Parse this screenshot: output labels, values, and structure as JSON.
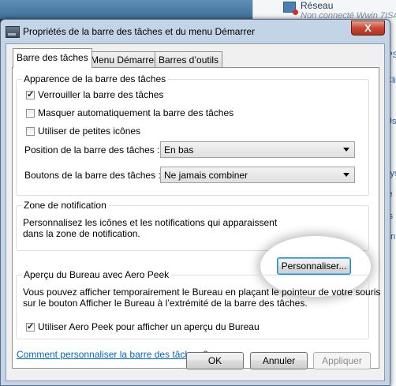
{
  "background": {
    "network_title": "Réseau",
    "network_status": "Non connecté Wwin 7ISA",
    "fragments": [
      "SPS",
      "Cli",
      "Us",
      "sys",
      "ie",
      "rs",
      "en"
    ]
  },
  "window": {
    "title": "Propriétés de la barre des tâches et du menu Démarrer",
    "close_label": "X"
  },
  "tabs": [
    {
      "label": "Barre des tâches"
    },
    {
      "label": "Menu Démarrer"
    },
    {
      "label": "Barres d’outils"
    }
  ],
  "appearance": {
    "group_label": "Apparence de la barre des tâches",
    "lock_label": "Verrouiller la barre des tâches",
    "lock_checked": true,
    "autohide_label": "Masquer automatiquement la barre des tâches",
    "autohide_checked": false,
    "small_icons_label": "Utiliser de petites icônes",
    "small_icons_checked": false,
    "position_label": "Position de la barre des tâches :",
    "position_value": "En bas",
    "buttons_label": "Boutons de la barre des tâches :",
    "buttons_value": "Ne jamais combiner"
  },
  "notification": {
    "group_label": "Zone de notification",
    "text_line1": "Personnalisez les icônes et les notifications qui apparaissent",
    "text_line2": "dans la zone de notification.",
    "customize_button": "Personnaliser..."
  },
  "aero_peek": {
    "group_label": "Aperçu du Bureau avec Aero Peek",
    "text_line1": "Vous pouvez afficher temporairement le Bureau en plaçant le pointeur de votre souris",
    "text_line2": "sur le bouton Afficher le Bureau à l’extrémité de la barre des tâches.",
    "checkbox_label": "Utiliser Aero Peek pour afficher un aperçu du Bureau",
    "checked": true
  },
  "help_link": "Comment personnaliser la barre des tâches ?",
  "buttons": {
    "ok": "OK",
    "cancel": "Annuler",
    "apply": "Appliquer"
  }
}
